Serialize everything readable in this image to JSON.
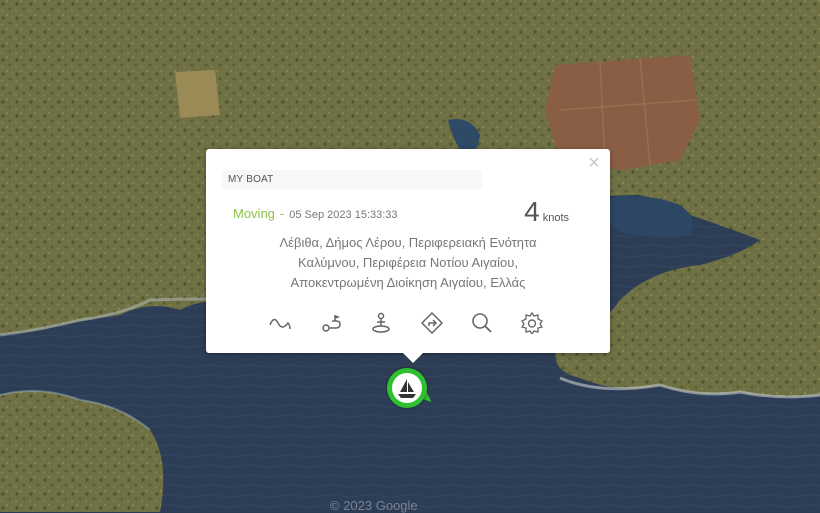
{
  "map": {
    "land_color": "#6f7145",
    "sea_color": "#2c3d55",
    "field_color": "#8a5e45",
    "attribution": "© 2023 Google"
  },
  "popup": {
    "close_label": "×",
    "boat_name": "MY BOAT",
    "status": "Moving",
    "separator": "-",
    "timestamp": "05 Sep 2023 15:33:33",
    "speed_value": "4",
    "speed_unit": "knots",
    "address_line1": "Λέβιθα, Δήμος Λέρου, Περιφερειακή Ενότητα",
    "address_line2": "Καλύμνου, Περιφέρεια Νοτίου Αιγαίου,",
    "address_line3": "Αποκεντρωμένη Διοίκηση Αιγαίου, Ελλάς",
    "status_color": "#8bc34a",
    "actions": [
      {
        "icon": "track-wave-icon"
      },
      {
        "icon": "route-icon"
      },
      {
        "icon": "anchor-person-icon"
      },
      {
        "icon": "directions-icon"
      },
      {
        "icon": "search-icon"
      },
      {
        "icon": "settings-icon"
      }
    ]
  },
  "marker": {
    "icon": "sailboat-icon",
    "color": "#2fbf2f"
  }
}
